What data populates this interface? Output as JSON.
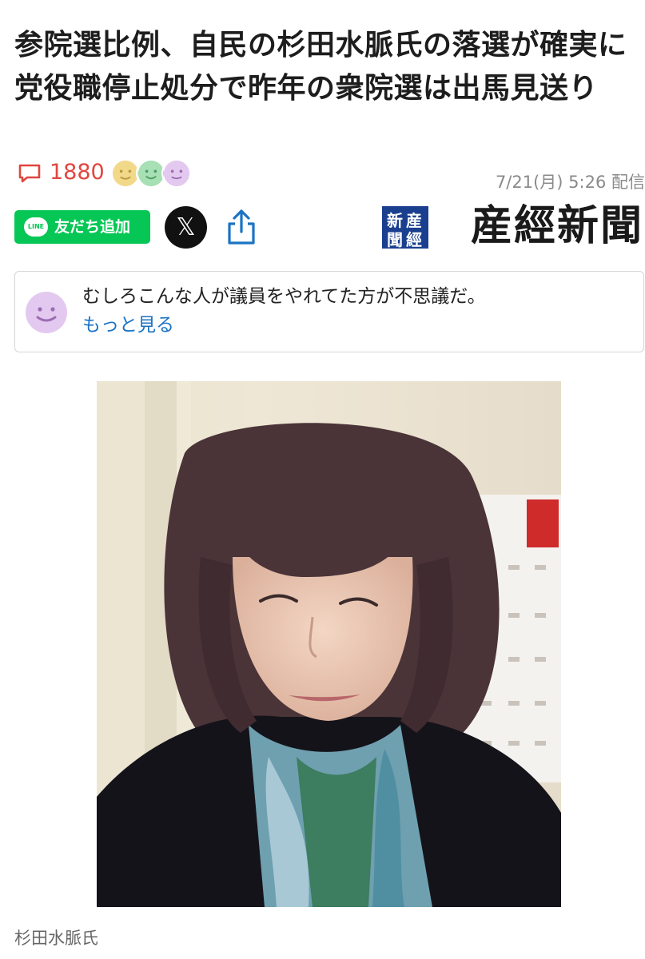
{
  "article": {
    "headline": "参院選比例、自民の杉田水脈氏の落選が確実に　党役職停止処分で昨年の衆院選は出馬見送り",
    "comment_count": "1880",
    "timestamp": "7/21(月) 5:26 配信",
    "publisher_mark_chars": [
      "産",
      "經",
      "新",
      "聞"
    ],
    "publisher_name": "産經新聞",
    "photo_caption": "杉田水脈氏"
  },
  "reactions": [
    {
      "name": "neutral",
      "color": "#f2d98a"
    },
    {
      "name": "agree",
      "color": "#a6e0b4"
    },
    {
      "name": "thinking",
      "color": "#e3c9ef"
    }
  ],
  "share": {
    "line_badge": "LINE",
    "line_label": "友だち追加",
    "x_label": "𝕏"
  },
  "top_comment": {
    "text": "むしろこんな人が議員をやれてた方が不思議だ。",
    "more_link": "もっと見る"
  },
  "colors": {
    "comment_red": "#e0463f",
    "line_green": "#06c755",
    "link_blue": "#1a73c4",
    "sankei_blue": "#1b3f8f"
  }
}
